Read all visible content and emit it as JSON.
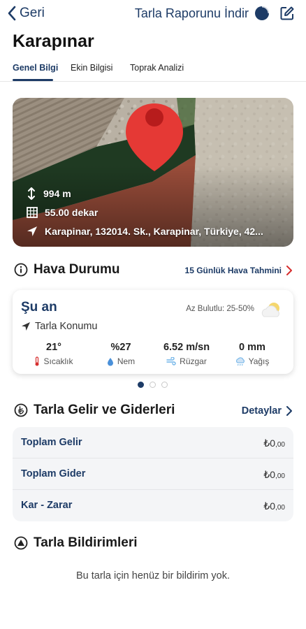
{
  "topbar": {
    "back_label": "Geri",
    "report_label": "Tarla Raporunu İndir"
  },
  "field": {
    "name": "Karapınar"
  },
  "tabs": [
    {
      "label": "Genel Bilgi",
      "active": true
    },
    {
      "label": "Ekin Bilgisi",
      "active": false
    },
    {
      "label": "Toprak Analizi",
      "active": false
    }
  ],
  "map": {
    "elevation": "994 m",
    "area": "55.00 dekar",
    "address": "Karapinar, 132014. Sk., Karapinar, Türkiye, 42..."
  },
  "weather": {
    "title": "Hava Durumu",
    "forecast_link": "15 Günlük Hava Tahmini",
    "now_label": "Şu an",
    "cloud_text": "Az Bulutlu: 25-50%",
    "location_label": "Tarla Konumu",
    "stats": [
      {
        "value": "21°",
        "label": "Sıcaklık",
        "icon": "thermometer-icon"
      },
      {
        "value": "%27",
        "label": "Nem",
        "icon": "droplet-icon"
      },
      {
        "value": "6.52 m/sn",
        "label": "Rüzgar",
        "icon": "wind-icon"
      },
      {
        "value": "0 mm",
        "label": "Yağış",
        "icon": "rain-cloud-icon"
      }
    ],
    "pager": {
      "count": 3,
      "active_index": 0
    }
  },
  "finance": {
    "title": "Tarla Gelir ve Giderleri",
    "details_link": "Detaylar",
    "rows": [
      {
        "label": "Toplam Gelir",
        "amount": "₺0",
        "decimals": ",00"
      },
      {
        "label": "Toplam Gider",
        "amount": "₺0",
        "decimals": ",00"
      },
      {
        "label": "Kar - Zarar",
        "amount": "₺0",
        "decimals": ",00"
      }
    ]
  },
  "notifications": {
    "title": "Tarla Bildirimleri",
    "empty_text": "Bu tarla için henüz bir bildirim yok."
  },
  "colors": {
    "primary": "#1d3b66",
    "accent_red": "#d62e2e"
  }
}
